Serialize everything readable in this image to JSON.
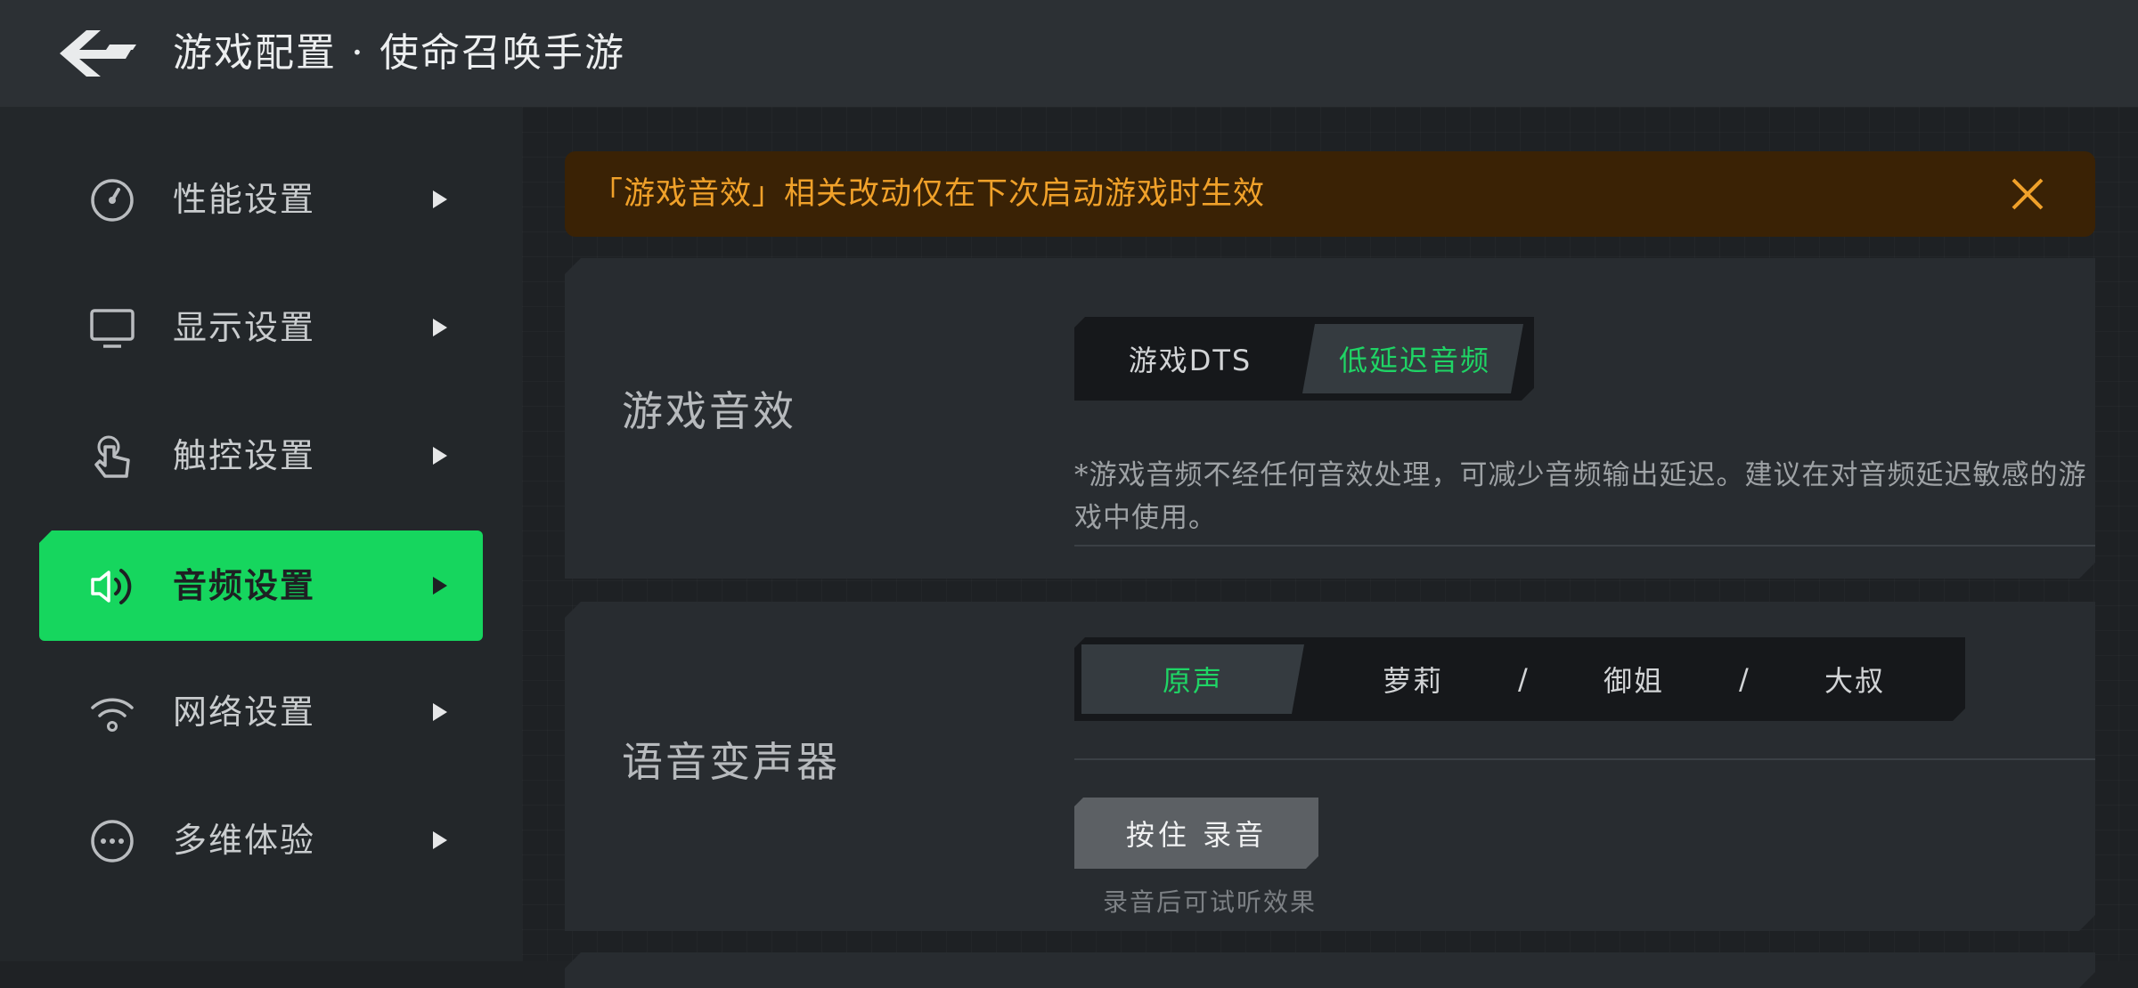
{
  "header": {
    "title": "游戏配置 · 使命召唤手游",
    "back_icon": "back-arrow-icon"
  },
  "sidebar": {
    "items": [
      {
        "label": "性能设置",
        "icon": "gauge-icon",
        "active": false
      },
      {
        "label": "显示设置",
        "icon": "monitor-icon",
        "active": false
      },
      {
        "label": "触控设置",
        "icon": "touch-icon",
        "active": false
      },
      {
        "label": "音频设置",
        "icon": "speaker-icon",
        "active": true
      },
      {
        "label": "网络设置",
        "icon": "wifi-icon",
        "active": false
      },
      {
        "label": "多维体验",
        "icon": "more-icon",
        "active": false
      }
    ]
  },
  "notice": {
    "text": "「游戏音效」相关改动仅在下次启动游戏时生效",
    "color": "#f0a12a"
  },
  "sound_effect": {
    "title": "游戏音效",
    "options": [
      "游戏DTS",
      "低延迟音频"
    ],
    "selected": "低延迟音频",
    "description": "*游戏音频不经任何音效处理，可减少音频输出延迟。建议在对音频延迟敏感的游戏中使用。"
  },
  "voice_changer": {
    "title": "语音变声器",
    "options": [
      "原声",
      "萝莉",
      "御姐",
      "大叔"
    ],
    "separators": [
      "/",
      "/"
    ],
    "selected": "原声",
    "record_button": "按住 录音",
    "hint": "录音后可试听效果"
  },
  "colors": {
    "accent": "#16d65e",
    "selected_text": "#1fd465",
    "warning": "#f0a12a"
  }
}
